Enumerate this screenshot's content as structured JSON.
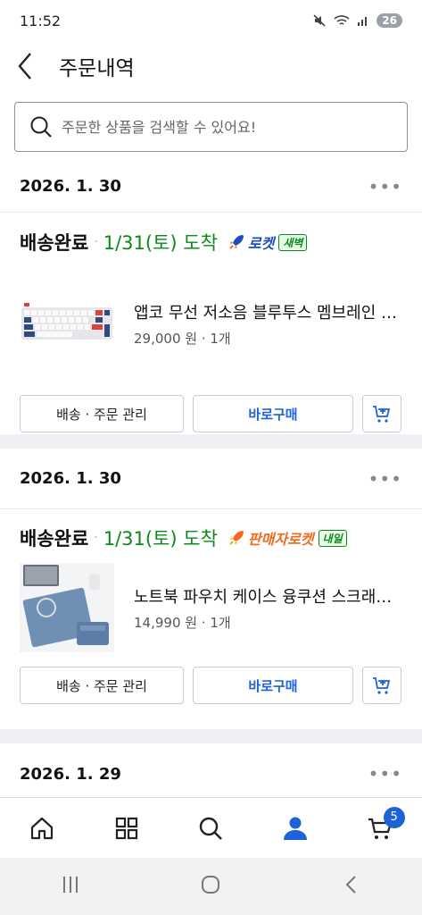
{
  "status_bar": {
    "time": "11:52",
    "battery": "26"
  },
  "header": {
    "title": "주문내역"
  },
  "search": {
    "placeholder": "주문한 상품을 검색할 수 있어요!"
  },
  "orders": [
    {
      "date": "2026. 1. 30",
      "status": "배송완료",
      "arrival": "1/31(토) 도착",
      "delivery_type": "로켓",
      "delivery_badge": "새벽",
      "rocket_color": "#1d4fb8",
      "product_name": "앱코 무선 저소음 블루투스 멤브레인 키보드",
      "price": "29,000 원",
      "qty": "1개",
      "manage_label": "배송 · 주문 관리",
      "buy_label": "바로구매"
    },
    {
      "date": "2026. 1. 30",
      "status": "배송완료",
      "arrival": "1/31(토) 도착",
      "delivery_type": "판매자로켓",
      "delivery_badge": "내일",
      "rocket_color": "#f26b1d",
      "product_name": "노트북 파우치 케이스 융쿠션 스크래치 방지",
      "price": "14,990 원",
      "qty": "1개",
      "manage_label": "배송 · 주문 관리",
      "buy_label": "바로구매"
    },
    {
      "date": "2026. 1. 29"
    }
  ],
  "bottom_nav": {
    "items": [
      "home-icon",
      "category-icon",
      "search-icon",
      "my-page-icon",
      "cart-icon"
    ],
    "cart_count": "5",
    "active_color": "#1d63d8"
  },
  "system_nav": [
    "recent-apps-icon",
    "home-button-icon",
    "back-icon"
  ]
}
